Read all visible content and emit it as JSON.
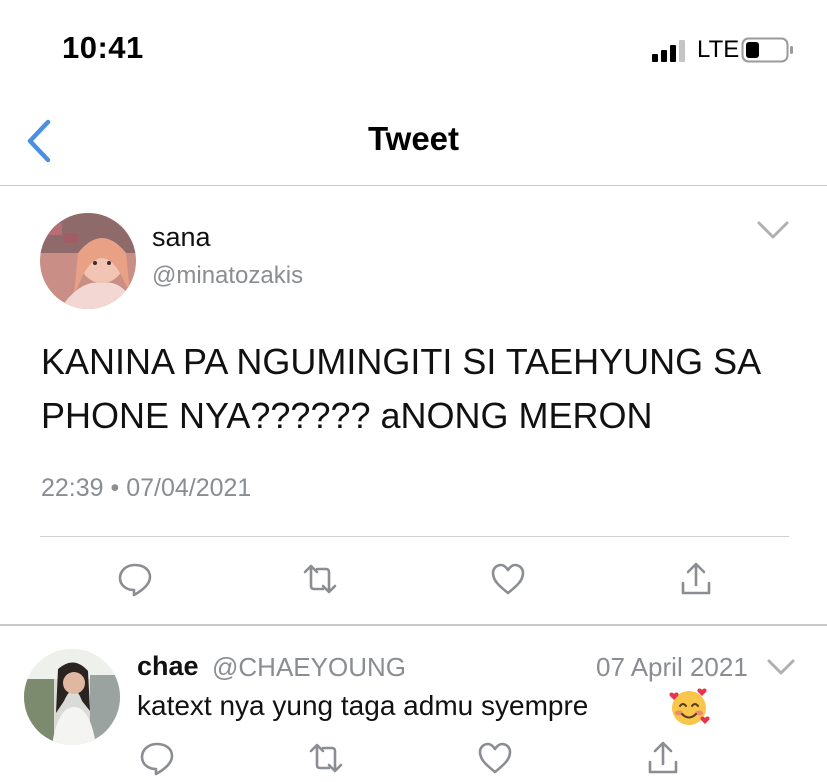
{
  "status_bar": {
    "time": "10:41",
    "network": "LTE",
    "signal_icon": "signal-bars-icon",
    "battery_icon": "battery-icon"
  },
  "nav": {
    "title": "Tweet",
    "back_icon": "back-chevron-icon",
    "accent": "#4a90e2"
  },
  "tweet": {
    "name": "sana",
    "handle": "@minatozakis",
    "text": "KANINA PA NGUMINGITI SI TAEHYUNG SA PHONE NYA?????? aNONG MERON",
    "timestamp": "22:39 • 07/04/2021",
    "actions": [
      "reply-icon",
      "retweet-icon",
      "like-icon",
      "share-icon"
    ]
  },
  "reply": {
    "name": "chae",
    "handle": "@CHAEYOUNG",
    "date": "07 April 2021",
    "text": "katext nya yung taga admu syempre",
    "emoji_icon": "smiling-face-with-hearts-icon",
    "actions": [
      "reply-icon",
      "retweet-icon",
      "like-icon",
      "share-icon"
    ]
  },
  "colors": {
    "icon_gray": "#8a8d91",
    "divider": "#c8c8c8"
  }
}
